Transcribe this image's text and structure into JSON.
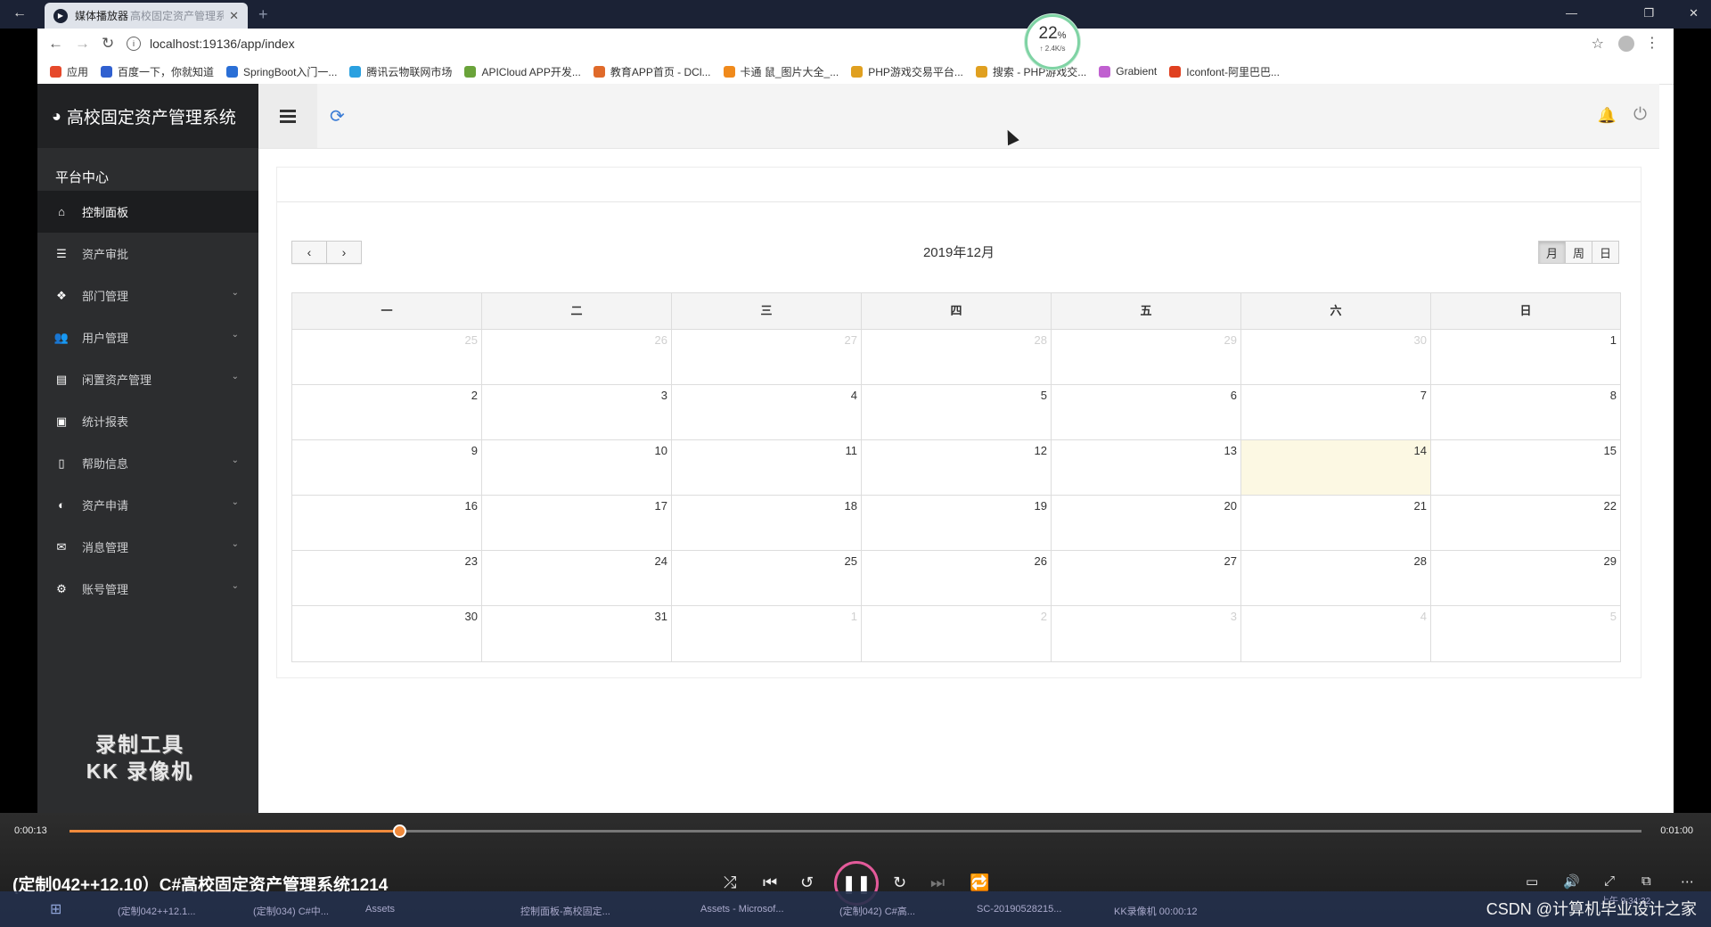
{
  "player": {
    "tab_title": "媒体播放器",
    "tab_subtitle": "高校固定资产管理系统",
    "speed_percent": "22",
    "speed_unit": "%",
    "speed_rate": "↑ 2.4K/s"
  },
  "browser": {
    "url": "localhost:19136/app/index",
    "bookmarks": [
      {
        "label": "应用",
        "color": "#e6492b"
      },
      {
        "label": "百度一下，你就知道",
        "color": "#3060d0"
      },
      {
        "label": "SpringBoot入门一...",
        "color": "#2a6fd6"
      },
      {
        "label": "腾讯云物联网市场",
        "color": "#2aa0e0"
      },
      {
        "label": "APICloud APP开发...",
        "color": "#6aa33a"
      },
      {
        "label": "教育APP首页 - DCl...",
        "color": "#e06a2a"
      },
      {
        "label": "卡通 鼠_图片大全_...",
        "color": "#f08a1c"
      },
      {
        "label": "PHP游戏交易平台...",
        "color": "#e0a020"
      },
      {
        "label": "搜索 - PHP游戏交...",
        "color": "#e0a020"
      },
      {
        "label": "Grabient",
        "color": "#c060d0"
      },
      {
        "label": "Iconfont-阿里巴巴...",
        "color": "#e04020"
      }
    ]
  },
  "app": {
    "title": "高校固定资产管理系统",
    "section": "平台中心",
    "menu": [
      {
        "label": "控制面板",
        "icon": "home-icon",
        "glyph": "⌂",
        "active": true,
        "caret": false
      },
      {
        "label": "资产审批",
        "icon": "list-icon",
        "glyph": "☰",
        "active": false,
        "caret": false
      },
      {
        "label": "部门管理",
        "icon": "cube-icon",
        "glyph": "❖",
        "active": false,
        "caret": true
      },
      {
        "label": "用户管理",
        "icon": "users-icon",
        "glyph": "👥",
        "active": false,
        "caret": true
      },
      {
        "label": "闲置资产管理",
        "icon": "file-text-icon",
        "glyph": "▤",
        "active": false,
        "caret": true
      },
      {
        "label": "统计报表",
        "icon": "image-icon",
        "glyph": "▣",
        "active": false,
        "caret": false
      },
      {
        "label": "帮助信息",
        "icon": "file-icon",
        "glyph": "▯",
        "active": false,
        "caret": true
      },
      {
        "label": "资产申请",
        "icon": "adjust-icon",
        "glyph": "◐",
        "active": false,
        "caret": true
      },
      {
        "label": "消息管理",
        "icon": "envelope-icon",
        "glyph": "✉",
        "active": false,
        "caret": true
      },
      {
        "label": "账号管理",
        "icon": "gears-icon",
        "glyph": "⚙",
        "active": false,
        "caret": true
      }
    ],
    "watermark_line1": "录制工具",
    "watermark_line2": "KK 录像机"
  },
  "calendar": {
    "title": "2019年12月",
    "views": [
      "月",
      "周",
      "日"
    ],
    "active_view": "月",
    "weekdays": [
      "一",
      "二",
      "三",
      "四",
      "五",
      "六",
      "日"
    ],
    "weeks": [
      [
        {
          "d": "25",
          "o": true
        },
        {
          "d": "26",
          "o": true
        },
        {
          "d": "27",
          "o": true
        },
        {
          "d": "28",
          "o": true
        },
        {
          "d": "29",
          "o": true
        },
        {
          "d": "30",
          "o": true
        },
        {
          "d": "1",
          "o": false
        }
      ],
      [
        {
          "d": "2",
          "o": false
        },
        {
          "d": "3",
          "o": false
        },
        {
          "d": "4",
          "o": false
        },
        {
          "d": "5",
          "o": false
        },
        {
          "d": "6",
          "o": false
        },
        {
          "d": "7",
          "o": false
        },
        {
          "d": "8",
          "o": false
        }
      ],
      [
        {
          "d": "9",
          "o": false
        },
        {
          "d": "10",
          "o": false
        },
        {
          "d": "11",
          "o": false
        },
        {
          "d": "12",
          "o": false
        },
        {
          "d": "13",
          "o": false
        },
        {
          "d": "14",
          "o": false,
          "t": true
        },
        {
          "d": "15",
          "o": false
        }
      ],
      [
        {
          "d": "16",
          "o": false
        },
        {
          "d": "17",
          "o": false
        },
        {
          "d": "18",
          "o": false
        },
        {
          "d": "19",
          "o": false
        },
        {
          "d": "20",
          "o": false
        },
        {
          "d": "21",
          "o": false
        },
        {
          "d": "22",
          "o": false
        }
      ],
      [
        {
          "d": "23",
          "o": false
        },
        {
          "d": "24",
          "o": false
        },
        {
          "d": "25",
          "o": false
        },
        {
          "d": "26",
          "o": false
        },
        {
          "d": "27",
          "o": false
        },
        {
          "d": "28",
          "o": false
        },
        {
          "d": "29",
          "o": false
        }
      ],
      [
        {
          "d": "30",
          "o": false
        },
        {
          "d": "31",
          "o": false
        },
        {
          "d": "1",
          "o": true
        },
        {
          "d": "2",
          "o": true
        },
        {
          "d": "3",
          "o": true
        },
        {
          "d": "4",
          "o": true
        },
        {
          "d": "5",
          "o": true
        }
      ]
    ]
  },
  "video": {
    "current_time": "0:00:13",
    "total_time": "0:01:00",
    "progress_fraction": 0.21,
    "title": "(定制042++12.10）C#高校固定资产管理系统1214"
  },
  "taskbar": {
    "items": [
      "(定制042++12.1...",
      "(定制034) C#中...",
      "Assets",
      "控制面板-高校固定...",
      "Assets - Microsof...",
      "(定制042) C#高...",
      "SC-20190528215...",
      "KK录像机 00:00:12"
    ],
    "clock": "上午 9:34:32"
  },
  "watermark": "CSDN @计算机毕业设计之家"
}
